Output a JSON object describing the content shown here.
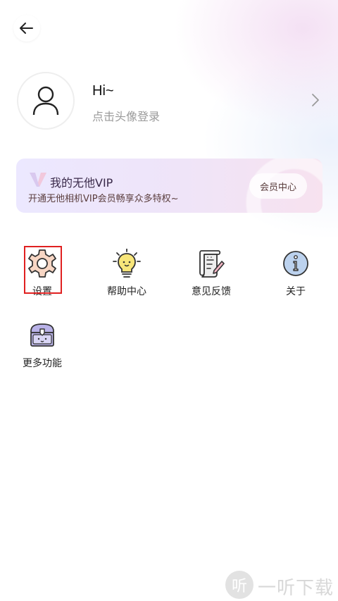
{
  "profile": {
    "greeting": "Hi~",
    "login_hint": "点击头像登录"
  },
  "vip": {
    "title": "我的无他VIP",
    "subtitle": "开通无他相机VIP会员畅享众多特权~",
    "center_button": "会员中心"
  },
  "menu": {
    "items": [
      {
        "label": "设置",
        "icon": "gear-icon"
      },
      {
        "label": "帮助中心",
        "icon": "lightbulb-icon"
      },
      {
        "label": "意见反馈",
        "icon": "feedback-scroll-icon"
      },
      {
        "label": "关于",
        "icon": "info-icon"
      },
      {
        "label": "更多功能",
        "icon": "treasure-chest-icon"
      }
    ]
  },
  "watermark": {
    "glyph": "听",
    "text": "一听下载"
  },
  "colors": {
    "highlight": "#e02020",
    "gear_fill": "#f7d6c4",
    "info_fill": "#bcd2ee",
    "bulb_fill": "#f8e67a",
    "chest_fill": "#b9b2e8"
  }
}
